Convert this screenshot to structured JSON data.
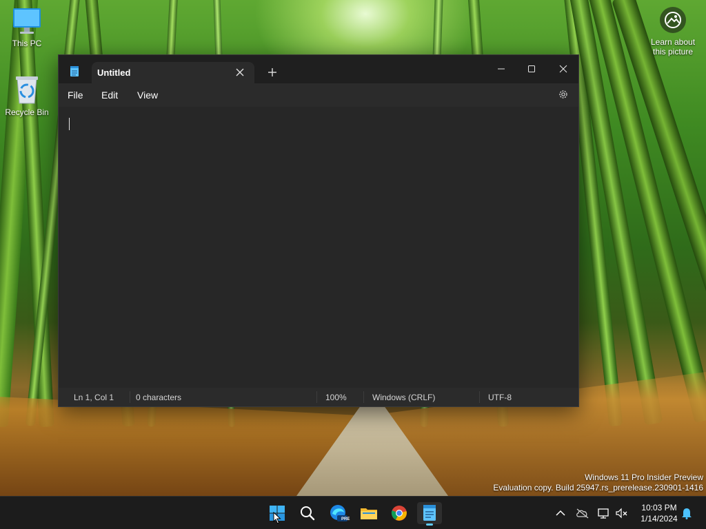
{
  "desktop": {
    "icons": [
      {
        "label": "This PC",
        "icon": "this-pc-icon"
      },
      {
        "label": "Recycle Bin",
        "icon": "recycle-bin-icon"
      }
    ],
    "spotlight": {
      "line1": "Learn about",
      "line2": "this picture"
    },
    "watermark": {
      "line1": "Windows 11 Pro Insider Preview",
      "line2": "Evaluation copy. Build 25947.rs_prerelease.230901-1416"
    }
  },
  "notepad": {
    "tab_title": "Untitled",
    "menu": [
      "File",
      "Edit",
      "View"
    ],
    "editor_text": "",
    "status": {
      "position": "Ln 1, Col 1",
      "characters": "0 characters",
      "zoom": "100%",
      "line_ending": "Windows (CRLF)",
      "encoding": "UTF-8"
    }
  },
  "taskbar": {
    "apps": [
      "start-icon",
      "search-icon",
      "edge-preview-icon",
      "file-explorer-icon",
      "chrome-icon",
      "notepad-icon"
    ],
    "edge_badge": "PRE",
    "clock": {
      "time": "10:03 PM",
      "date": "1/14/2024"
    }
  },
  "colors": {
    "window_bg": "#202020",
    "editor_bg": "#272727",
    "accent": "#60cdff",
    "taskbar_bg": "#1c1c1c"
  }
}
